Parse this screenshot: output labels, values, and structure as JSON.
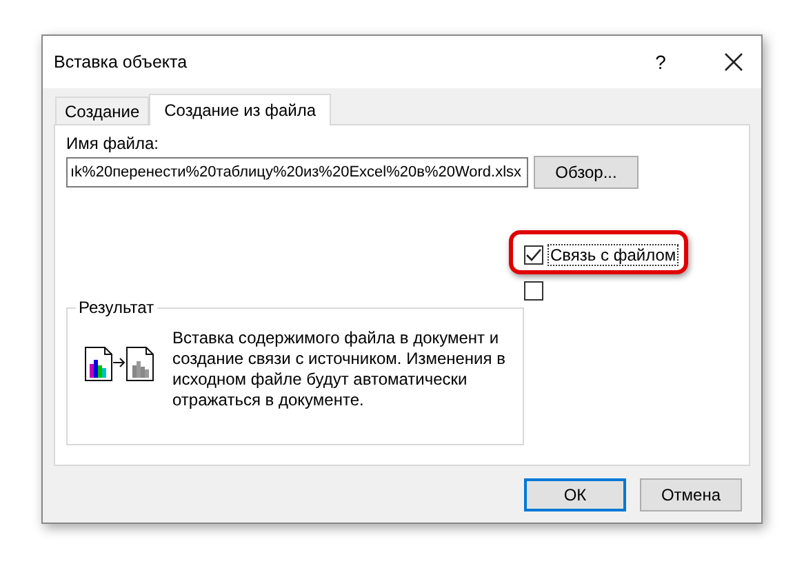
{
  "window": {
    "title": "Вставка объекта",
    "help": "?"
  },
  "tabs": [
    {
      "label": "Создание",
      "selected": false
    },
    {
      "label": "Создание из файла",
      "selected": true
    }
  ],
  "file_name": {
    "label": "Имя файла:",
    "value": "ık%20перенести%20таблицу%20из%20Excel%20в%20Word.xlsx"
  },
  "browse_button": "Обзор...",
  "checkboxes": [
    {
      "label": "Связь с файлом",
      "checked": true,
      "highlighted": true
    },
    {
      "checked": false,
      "highlighted": false
    }
  ],
  "result": {
    "title": "Результат",
    "text": "Вставка содержимого файла в документ и создание связи с источником.  Изменения в исходном файле будут автоматически отражаться в документе."
  },
  "buttons": [
    {
      "label": "ОК",
      "default": true
    },
    {
      "label": "Отмена",
      "default": false
    }
  ]
}
